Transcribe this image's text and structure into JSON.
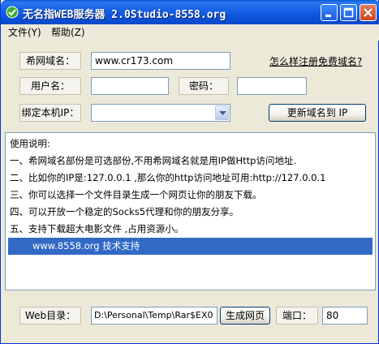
{
  "window": {
    "title": "无名指WEB服务器 2.0Studio-8558.org"
  },
  "menu": [
    {
      "label": "文件(Y)"
    },
    {
      "label": "帮助(Z)"
    }
  ],
  "form": {
    "domain_label": "希网域名：",
    "domain_value": "www.cr173.com",
    "register_link": "怎么样注册免费域名?",
    "username_label": "用户名：",
    "username_value": "",
    "password_label": "密码：",
    "password_value": "",
    "bind_ip_label": "绑定本机IP：",
    "bind_ip_value": "",
    "update_button": "更新域名到 IP"
  },
  "instructions": [
    "使用说明:",
    "一、希网域名部份是可选部份,不用希网域名就是用IP做Http访问地址.",
    "二、比如你的IP是:127.0.0.1 ,那么你的http访问地址可用:http://127.0.0.1",
    "三、你可以选择一个文件目录生成一个网页让你的朋友下载。",
    "四、可以开放一个稳定的Socks5代理和你的朋友分享。",
    "五、支持下载超大电影文件 ,占用资源小。",
    "www.8558.org 技术支持"
  ],
  "bottom": {
    "web_dir_label": "Web目录：",
    "web_dir_value": "D:\\Personal\\Temp\\Rar$EX0",
    "generate_button": "生成网页",
    "port_label": "端口：",
    "port_value": "80"
  },
  "colors": {
    "titlebar": "#0a5ad8",
    "selection": "#316ac5",
    "window_bg": "#ece9d8"
  }
}
